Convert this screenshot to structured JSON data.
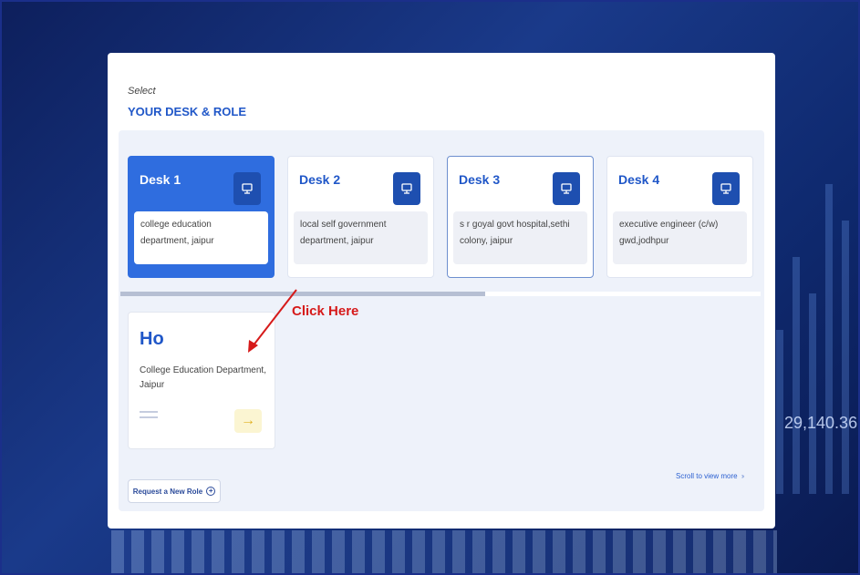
{
  "header": {
    "select_label": "Select",
    "title": "YOUR DESK & ROLE"
  },
  "desks": [
    {
      "title": "Desk 1",
      "description": "college education department, jaipur",
      "icon": "monitor-icon",
      "state": "selected"
    },
    {
      "title": "Desk 2",
      "description": "local self government department, jaipur",
      "icon": "monitor-icon",
      "state": "default"
    },
    {
      "title": "Desk 3",
      "description": "s r goyal govt hospital,sethi colony, jaipur",
      "icon": "monitor-icon",
      "state": "outlined"
    },
    {
      "title": "Desk 4",
      "description": "executive engineer (c/w) gwd,jodhpur",
      "icon": "monitor-icon",
      "state": "default"
    }
  ],
  "desk_scroll_fraction": 0.57,
  "role": {
    "title": "Ho",
    "description": "College Education Department, Jaipur",
    "arrow_icon": "arrow-right-icon"
  },
  "scroll_hint": "Scroll to view more",
  "request_button": "Request a New Role",
  "annotation": "Click Here",
  "background_number": "29,140.36",
  "colors": {
    "accent": "#2057c8",
    "selected_card": "#2f6ddf",
    "annotation": "#d61a1a"
  }
}
